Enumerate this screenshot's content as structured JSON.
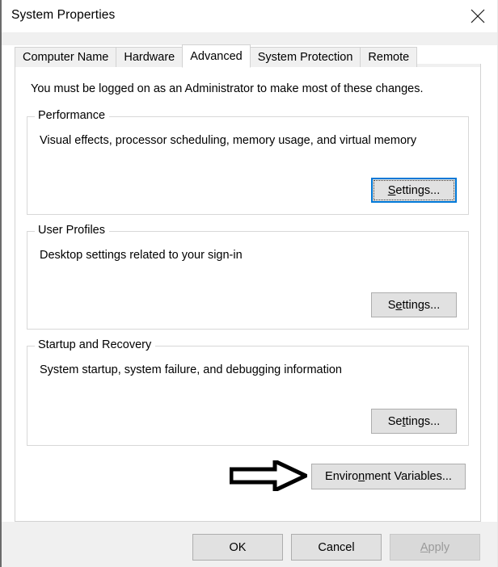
{
  "window": {
    "title": "System Properties",
    "close_icon": "close-icon"
  },
  "tabs": [
    {
      "label": "Computer Name",
      "selected": false
    },
    {
      "label": "Hardware",
      "selected": false
    },
    {
      "label": "Advanced",
      "selected": true
    },
    {
      "label": "System Protection",
      "selected": false
    },
    {
      "label": "Remote",
      "selected": false
    }
  ],
  "main": {
    "admin_notice": "You must be logged on as an Administrator to make most of these changes.",
    "groups": [
      {
        "legend": "Performance",
        "description": "Visual effects, processor scheduling, memory usage, and virtual memory",
        "button": {
          "label_before": "",
          "accel": "S",
          "label_after": "ettings...",
          "focused": true
        }
      },
      {
        "legend": "User Profiles",
        "description": "Desktop settings related to your sign-in",
        "button": {
          "label_before": "S",
          "accel": "e",
          "label_after": "ttings...",
          "focused": false
        }
      },
      {
        "legend": "Startup and Recovery",
        "description": "System startup, system failure, and debugging information",
        "button": {
          "label_before": "Se",
          "accel": "t",
          "label_after": "tings...",
          "focused": false
        }
      }
    ],
    "env_vars_button": {
      "label_before": "Enviro",
      "accel": "n",
      "label_after": "ment Variables..."
    },
    "annotation": {
      "name": "arrow-annotation",
      "points_to": "env-vars-button",
      "color": "#000000"
    }
  },
  "footer": {
    "ok_label": "OK",
    "cancel_label": "Cancel",
    "apply": {
      "label_before": "",
      "accel": "A",
      "label_after": "pply",
      "disabled": true
    }
  },
  "colors": {
    "accent": "#0078d7",
    "button_face": "#e1e1e1",
    "button_border": "#adadad",
    "panel": "#ffffff",
    "chrome": "#f0f0f0",
    "group_border": "#d8d8d8",
    "disabled_text": "#9a9a9a"
  }
}
